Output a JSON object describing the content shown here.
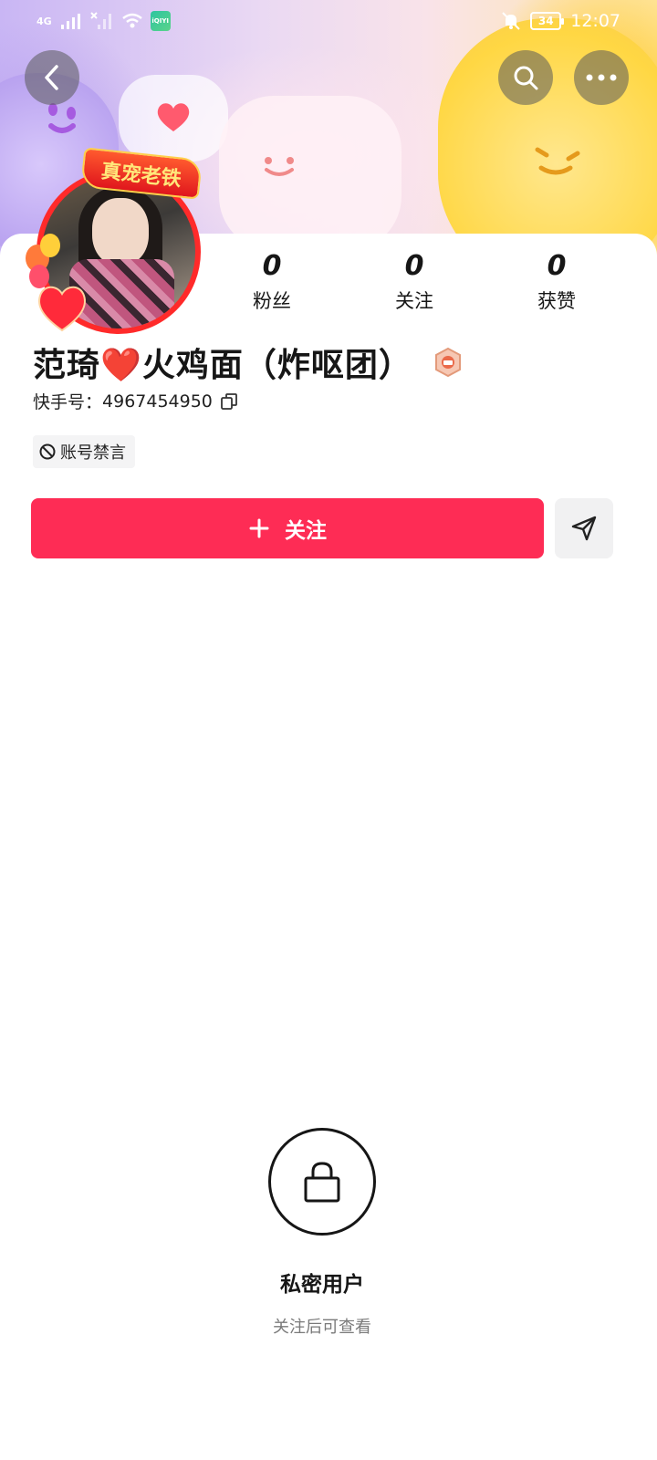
{
  "status_bar": {
    "network_label": "4G",
    "app_chip_label": "iQIYI",
    "battery_level": "34",
    "time": "12:07"
  },
  "header": {
    "back_icon": "chevron-left-icon",
    "search_icon": "search-icon",
    "more_icon": "more-horizontal-icon"
  },
  "avatar": {
    "frame_text": "真宠老铁"
  },
  "stats": [
    {
      "value": "0",
      "label": "粉丝"
    },
    {
      "value": "0",
      "label": "关注"
    },
    {
      "value": "0",
      "label": "获赞"
    }
  ],
  "profile": {
    "name": "范琦❤️火鸡面（炸呕团）",
    "id_label": "快手号：",
    "id_value": "4967454950",
    "tag": "账号禁言"
  },
  "actions": {
    "follow_label": "关注",
    "accent_color": "#fe2c55"
  },
  "private": {
    "title": "私密用户",
    "subtitle": "关注后可查看"
  }
}
